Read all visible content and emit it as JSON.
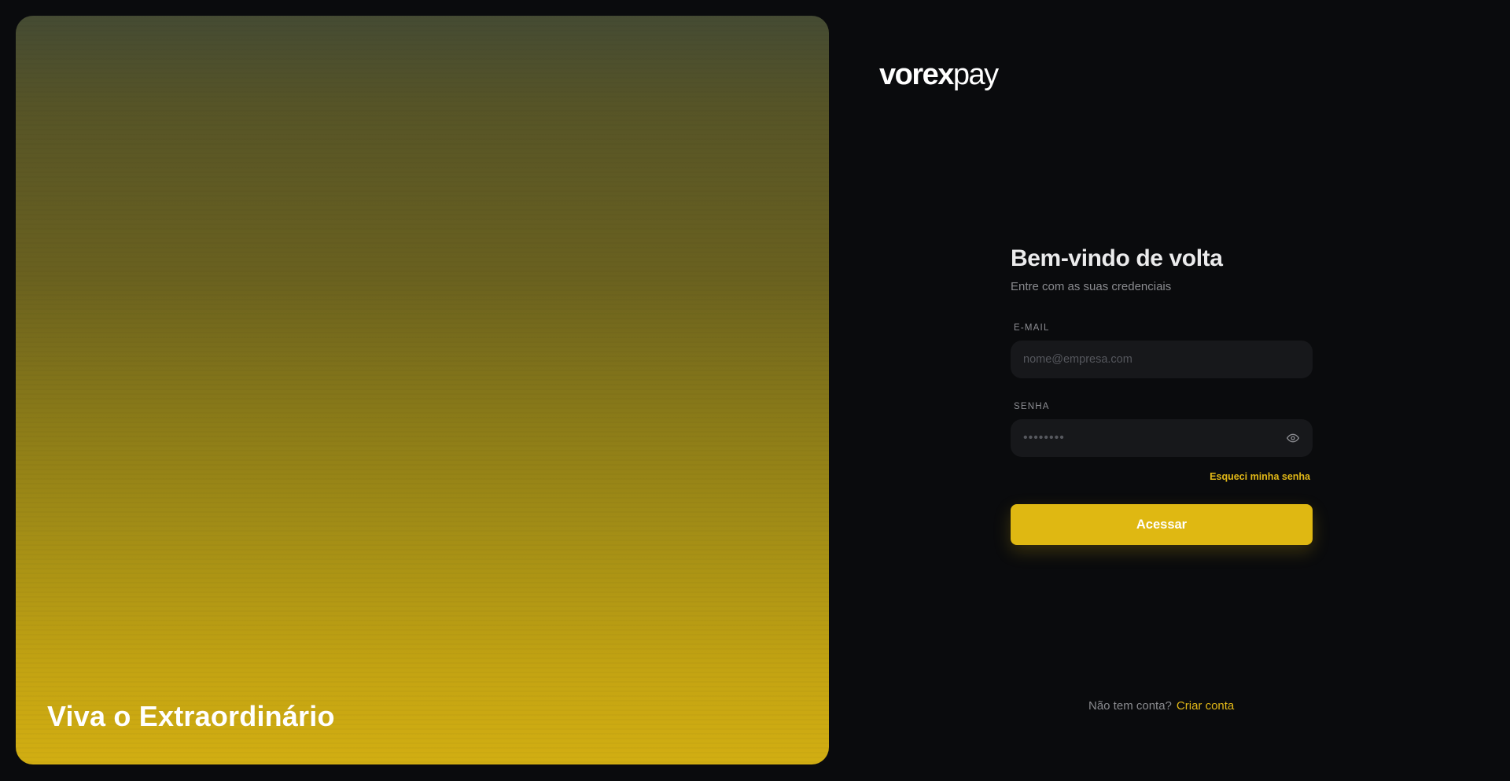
{
  "hero": {
    "tagline": "Viva o Extraordinário"
  },
  "brand": {
    "name_strong": "vorex",
    "name_light": "pay"
  },
  "login": {
    "title": "Bem-vindo de volta",
    "subtitle": "Entre com as suas credenciais",
    "email": {
      "label": "E-MAIL",
      "placeholder": "nome@empresa.com",
      "value": ""
    },
    "password": {
      "label": "SENHA",
      "masked_value": "••••••••"
    },
    "forgot_label": "Esqueci minha senha",
    "submit_label": "Acessar"
  },
  "signup": {
    "prompt": "Não tem conta?",
    "link_label": "Criar conta"
  },
  "colors": {
    "accent": "#dfb812",
    "background": "#0a0b0d",
    "input_bg": "#17181b"
  },
  "icons": {
    "toggle_password": "eye-icon"
  }
}
